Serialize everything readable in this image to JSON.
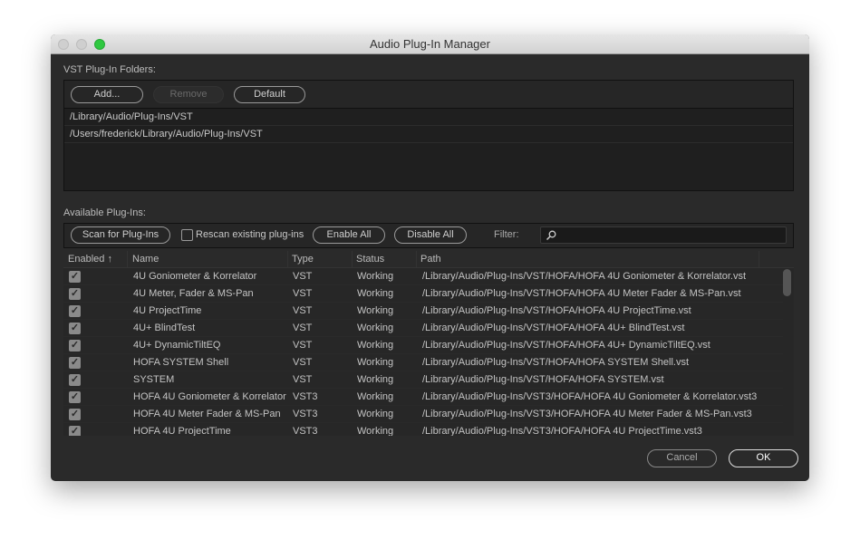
{
  "window": {
    "title": "Audio Plug-In Manager"
  },
  "folders": {
    "label": "VST Plug-In Folders:",
    "add": "Add...",
    "remove": "Remove",
    "default": "Default",
    "items": [
      "/Library/Audio/Plug-Ins/VST",
      "/Users/frederick/Library/Audio/Plug-Ins/VST"
    ]
  },
  "plugins": {
    "label": "Available Plug-Ins:",
    "scan": "Scan for Plug-Ins",
    "rescan": "Rescan existing plug-ins",
    "rescan_checked": false,
    "enable_all": "Enable All",
    "disable_all": "Disable All",
    "filter_label": "Filter:",
    "filter_value": "",
    "columns": {
      "enabled": "Enabled",
      "name": "Name",
      "type": "Type",
      "status": "Status",
      "path": "Path"
    },
    "sort_icon": "arrow-up",
    "rows": [
      {
        "enabled": true,
        "name": "4U Goniometer & Korrelator",
        "type": "VST",
        "status": "Working",
        "path": "/Library/Audio/Plug-Ins/VST/HOFA/HOFA 4U Goniometer & Korrelator.vst"
      },
      {
        "enabled": true,
        "name": "4U Meter, Fader & MS-Pan",
        "type": "VST",
        "status": "Working",
        "path": "/Library/Audio/Plug-Ins/VST/HOFA/HOFA 4U Meter Fader & MS-Pan.vst"
      },
      {
        "enabled": true,
        "name": "4U ProjectTime",
        "type": "VST",
        "status": "Working",
        "path": "/Library/Audio/Plug-Ins/VST/HOFA/HOFA 4U ProjectTime.vst"
      },
      {
        "enabled": true,
        "name": "4U+ BlindTest",
        "type": "VST",
        "status": "Working",
        "path": "/Library/Audio/Plug-Ins/VST/HOFA/HOFA 4U+ BlindTest.vst"
      },
      {
        "enabled": true,
        "name": "4U+ DynamicTiltEQ",
        "type": "VST",
        "status": "Working",
        "path": "/Library/Audio/Plug-Ins/VST/HOFA/HOFA 4U+ DynamicTiltEQ.vst"
      },
      {
        "enabled": true,
        "name": "HOFA SYSTEM Shell",
        "type": "VST",
        "status": "Working",
        "path": "/Library/Audio/Plug-Ins/VST/HOFA/HOFA SYSTEM Shell.vst"
      },
      {
        "enabled": true,
        "name": "SYSTEM",
        "type": "VST",
        "status": "Working",
        "path": "/Library/Audio/Plug-Ins/VST/HOFA/HOFA SYSTEM.vst"
      },
      {
        "enabled": true,
        "name": "HOFA 4U Goniometer & Korrelator",
        "type": "VST3",
        "status": "Working",
        "path": "/Library/Audio/Plug-Ins/VST3/HOFA/HOFA 4U Goniometer & Korrelator.vst3"
      },
      {
        "enabled": true,
        "name": "HOFA 4U Meter Fader & MS-Pan",
        "type": "VST3",
        "status": "Working",
        "path": "/Library/Audio/Plug-Ins/VST3/HOFA/HOFA 4U Meter Fader & MS-Pan.vst3"
      },
      {
        "enabled": true,
        "name": "HOFA 4U ProjectTime",
        "type": "VST3",
        "status": "Working",
        "path": "/Library/Audio/Plug-Ins/VST3/HOFA/HOFA 4U ProjectTime.vst3"
      }
    ]
  },
  "footer": {
    "cancel": "Cancel",
    "ok": "OK"
  },
  "colors": {
    "close": "#cfcfcf",
    "minimize": "#cfcfcf",
    "zoom": "#2fc840"
  }
}
